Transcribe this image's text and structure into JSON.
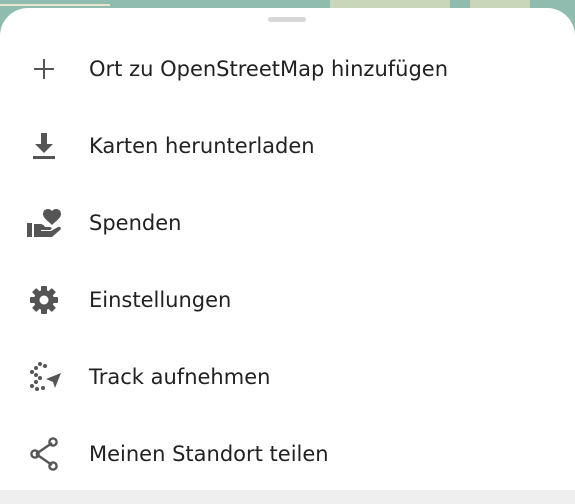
{
  "menu": {
    "items": [
      {
        "label": "Ort zu OpenStreetMap hinzufügen",
        "icon": "plus-icon"
      },
      {
        "label": "Karten herunterladen",
        "icon": "download-icon"
      },
      {
        "label": "Spenden",
        "icon": "donate-hand-heart-icon"
      },
      {
        "label": "Einstellungen",
        "icon": "gear-icon"
      },
      {
        "label": "Track aufnehmen",
        "icon": "track-record-icon"
      },
      {
        "label": "Meinen Standort teilen",
        "icon": "share-icon"
      }
    ]
  },
  "colors": {
    "text": "#212121",
    "icon": "#555555",
    "sheet_bg": "#ffffff",
    "map_water": "#8fbcae"
  }
}
